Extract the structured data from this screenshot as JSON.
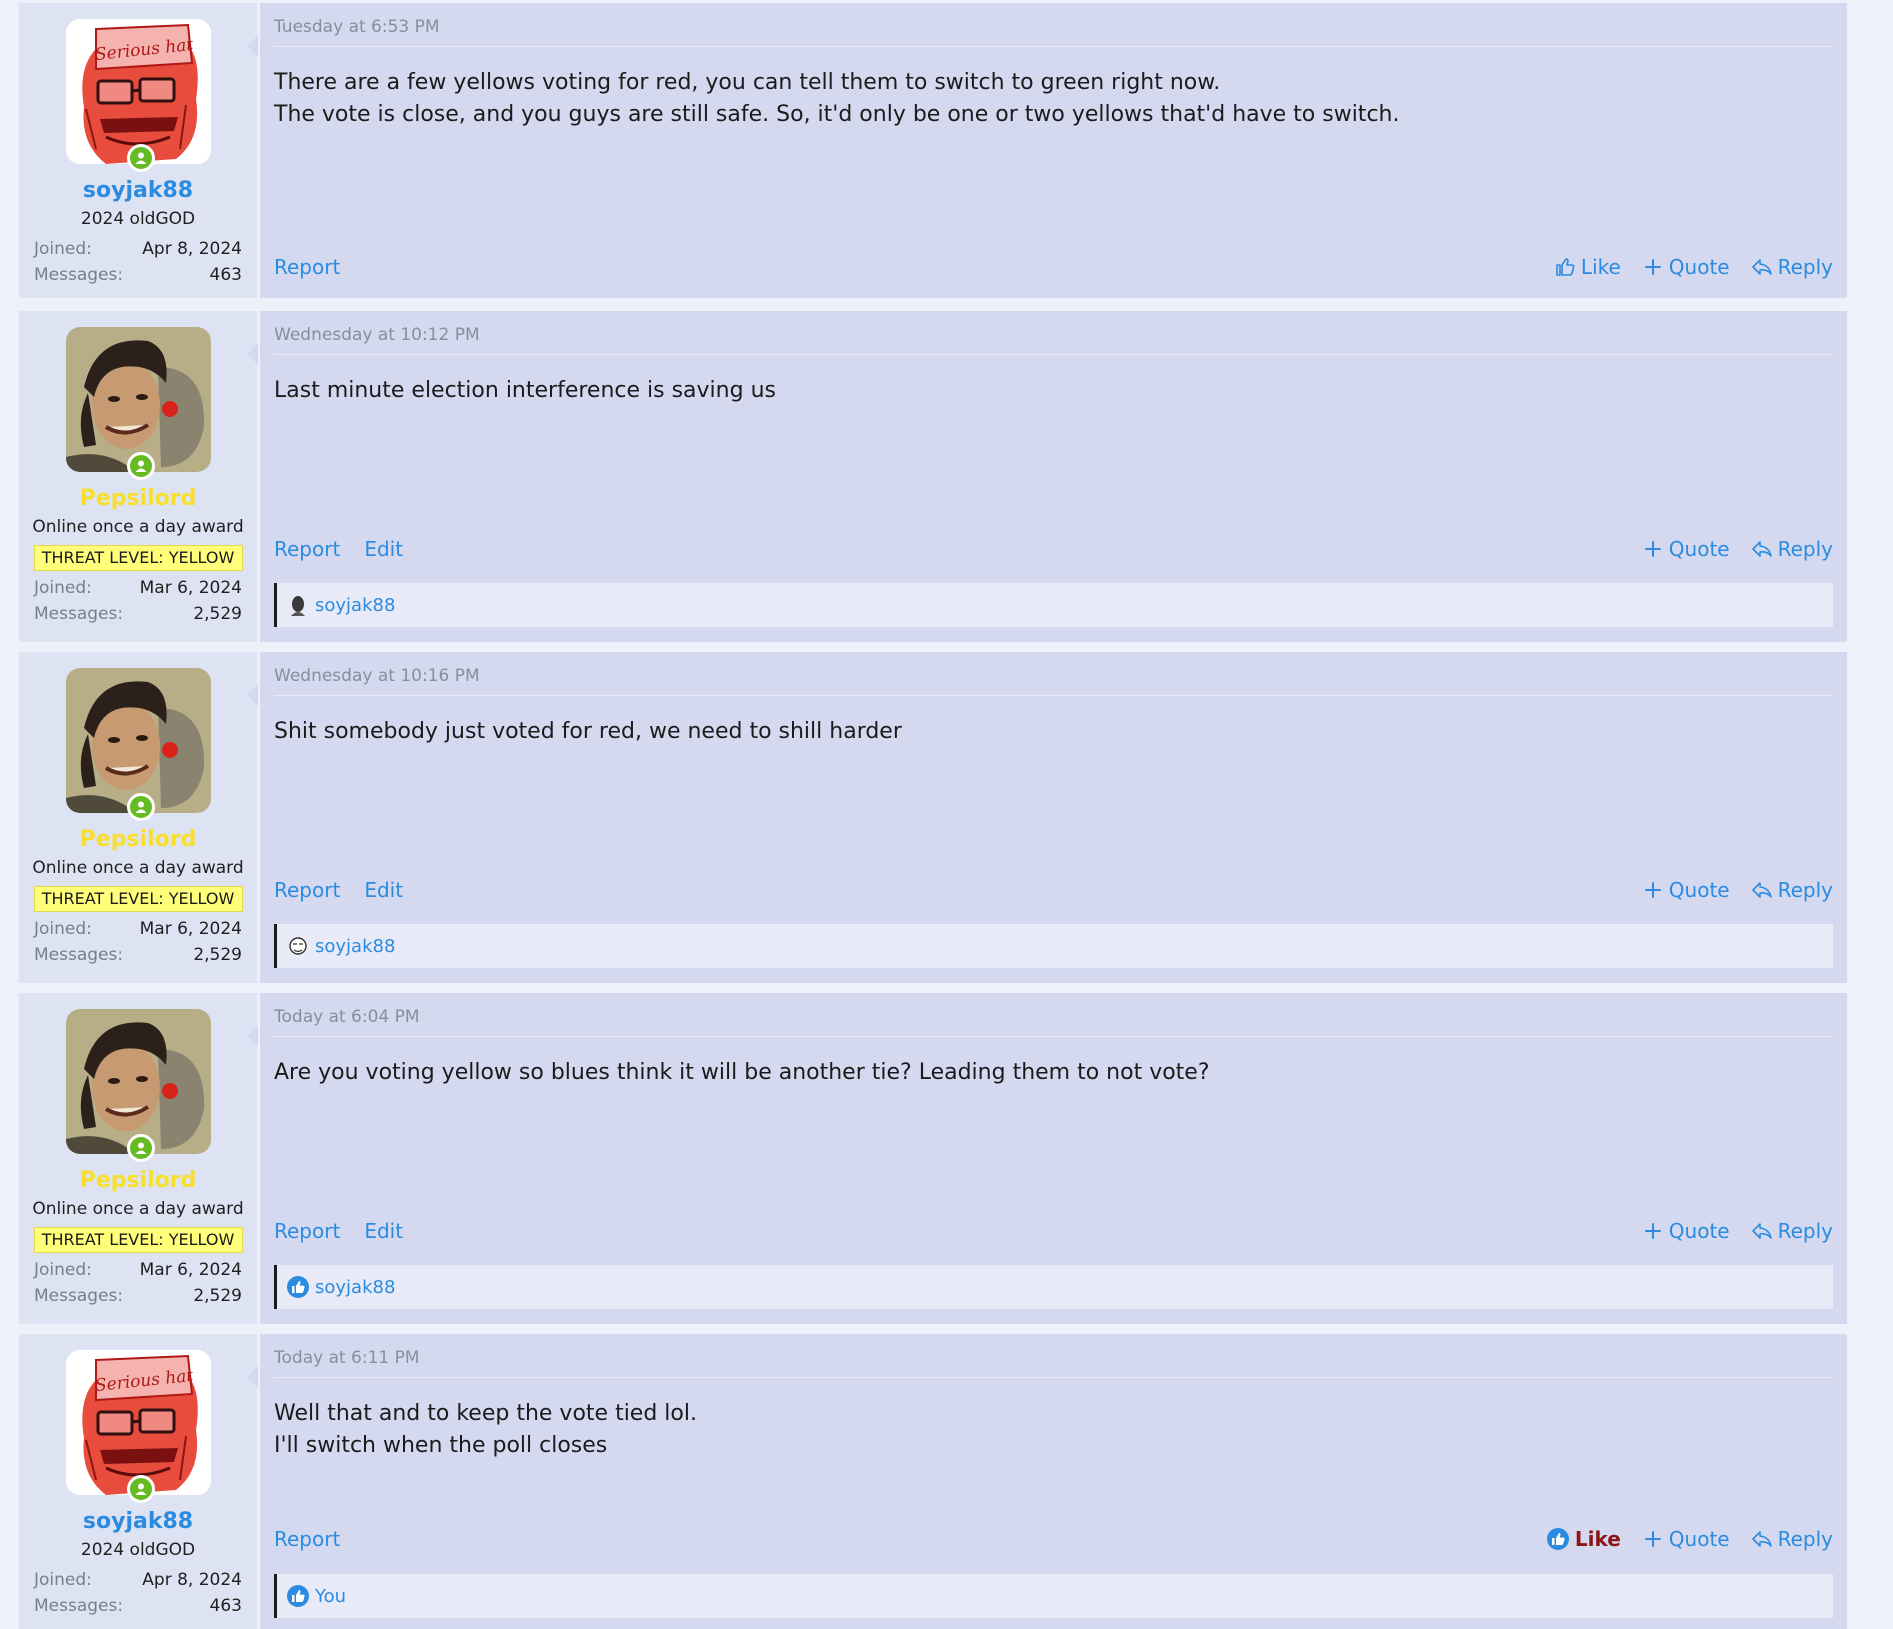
{
  "colors": {
    "link_blue": "#2b8be0",
    "yellow_username": "#f7df2a",
    "banner_bg": "#ffff7a",
    "liked_red": "#8a1515",
    "online_green": "#66bb22"
  },
  "labels": {
    "joined": "Joined:",
    "messages": "Messages:",
    "report": "Report",
    "edit": "Edit",
    "like": "Like",
    "quote": "Quote",
    "reply": "Reply"
  },
  "users": {
    "soyjak88": {
      "name": "soyjak88",
      "title": "2024 oldGOD",
      "joined": "Apr 8, 2024",
      "messages": "463",
      "avatar_text": "Serious hat"
    },
    "pepsilord": {
      "name": "Pepsilord",
      "title": "Online once a day award",
      "banner": "THREAT LEVEL: YELLOW",
      "joined": "Mar 6, 2024",
      "messages": "2,529"
    }
  },
  "posts": [
    {
      "date": "Tuesday at 6:53 PM",
      "lines": [
        "There are a few yellows voting for red, you can tell them to switch to green right now.",
        "The vote is close, and you guys are still safe. So, it'd only be one or two yellows that'd have to switch."
      ]
    },
    {
      "date": "Wednesday at 10:12 PM",
      "lines": [
        "Last minute election interference is saving us"
      ],
      "reaction_user": "soyjak88"
    },
    {
      "date": "Wednesday at 10:16 PM",
      "lines": [
        "Shit somebody just voted for red, we need to shill harder"
      ],
      "reaction_user": "soyjak88"
    },
    {
      "date": "Today at 6:04 PM",
      "lines": [
        "Are you voting yellow so blues think it will be another tie? Leading them to not vote?"
      ],
      "reaction_user": "soyjak88"
    },
    {
      "date": "Today at 6:11 PM",
      "lines": [
        "Well that and to keep the vote tied lol.",
        "I'll switch when the poll closes"
      ],
      "reaction_user": "You"
    }
  ]
}
